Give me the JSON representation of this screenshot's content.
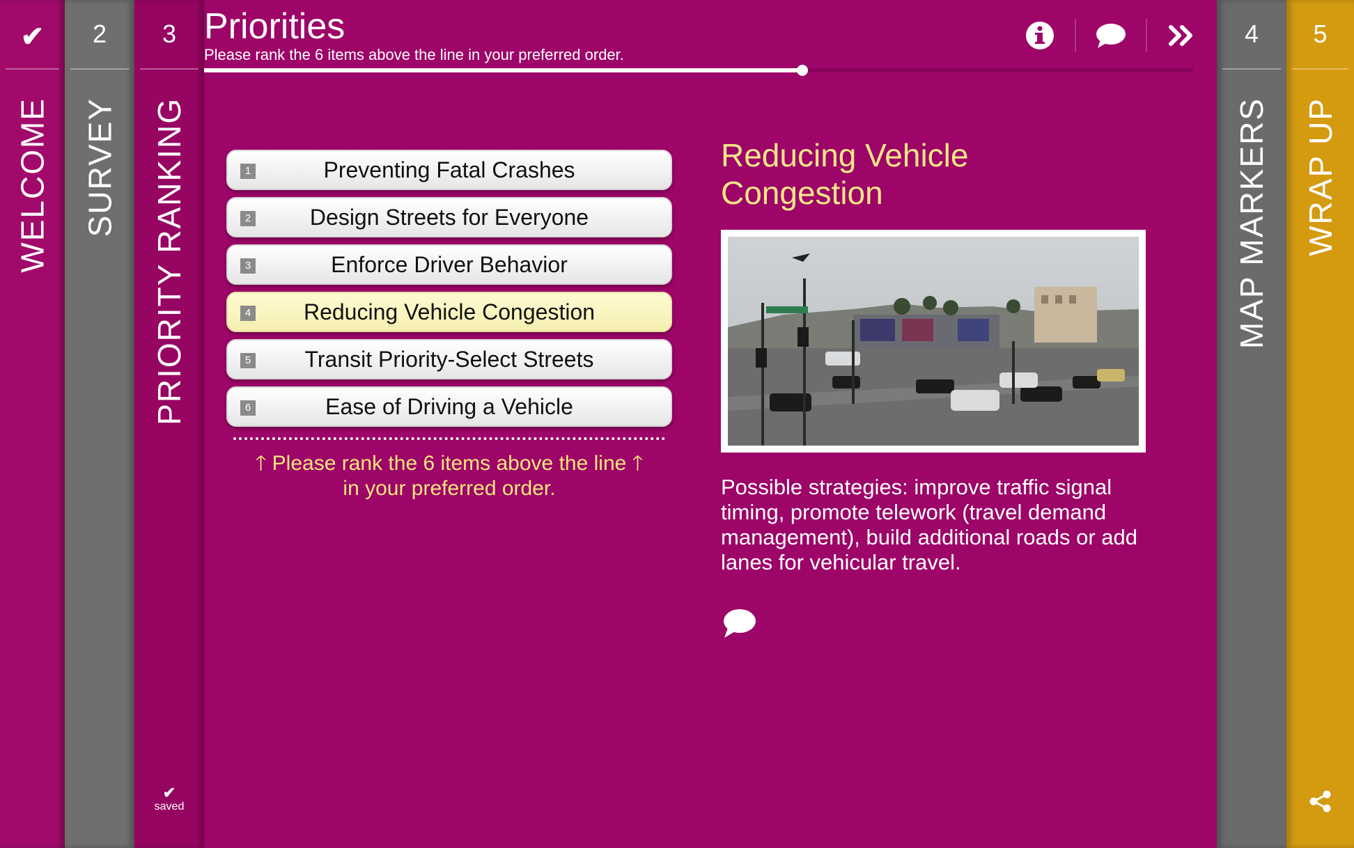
{
  "steps": {
    "welcome": {
      "label": "WELCOME",
      "status": "complete"
    },
    "survey": {
      "number": "2",
      "label": "SURVEY"
    },
    "priority_ranking": {
      "number": "3",
      "label": "PRIORITY RANKING",
      "saved_label": "saved"
    },
    "map_markers": {
      "number": "4",
      "label": "MAP MARKERS"
    },
    "wrap_up": {
      "number": "5",
      "label": "WRAP UP"
    }
  },
  "header": {
    "title": "Priorities",
    "subtitle": "Please rank the 6 items above the line in your preferred order.",
    "progress": 0.605
  },
  "ranking": {
    "items": [
      {
        "number": "1",
        "label": "Preventing Fatal Crashes"
      },
      {
        "number": "2",
        "label": "Design Streets for Everyone"
      },
      {
        "number": "3",
        "label": "Enforce Driver Behavior"
      },
      {
        "number": "4",
        "label": "Reducing Vehicle Congestion",
        "selected": true
      },
      {
        "number": "5",
        "label": "Transit Priority-Select Streets"
      },
      {
        "number": "6",
        "label": "Ease of Driving a Vehicle"
      }
    ],
    "hint_line1": "Please rank the 6 items above the line",
    "hint_line2": "in your preferred order."
  },
  "detail": {
    "title": "Reducing Vehicle Congestion",
    "description": "Possible strategies: improve traffic signal timing, promote telework (travel demand management), build additional roads or add lanes for vehicular travel."
  },
  "colors": {
    "main_bg": "#9d0568",
    "accent_yellow": "#f7e787",
    "wrap_up_gold": "#d49a10",
    "inactive_gray": "#6f6f6f"
  },
  "icons": [
    "check-icon",
    "info-icon",
    "comment-icon",
    "fast-forward-icon",
    "share-icon",
    "up-arrow-icon"
  ]
}
